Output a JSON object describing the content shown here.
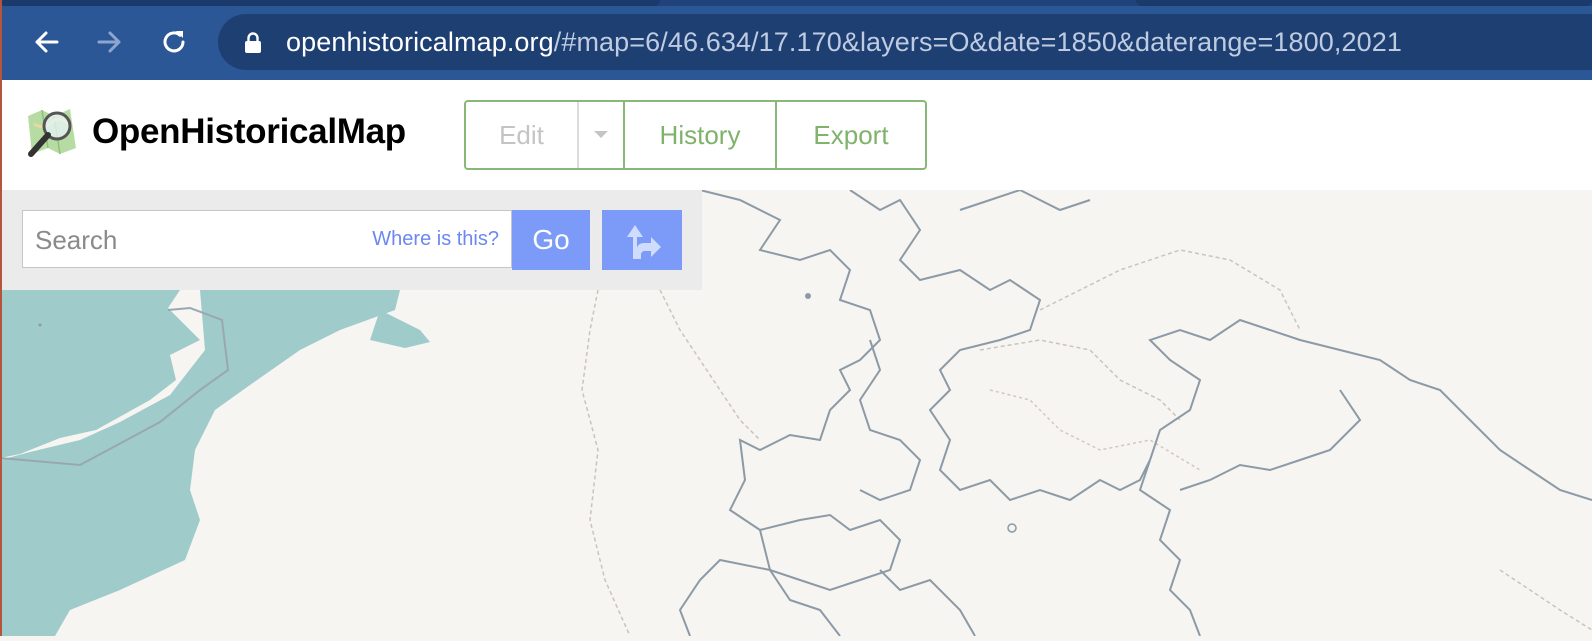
{
  "browser": {
    "url_domain": "openhistoricalmap.org",
    "url_rest": "/#map=6/46.634/17.170&layers=O&date=1850&daterange=1800,2021",
    "back_icon": "arrow-left-icon",
    "forward_icon": "arrow-right-icon",
    "reload_icon": "reload-icon",
    "lock_icon": "lock-icon"
  },
  "header": {
    "brand": "OpenHistoricalMap",
    "logo_icon": "magnifier-map-logo",
    "edit_label": "Edit",
    "history_label": "History",
    "export_label": "Export"
  },
  "search": {
    "placeholder": "Search",
    "where_label": "Where is this?",
    "go_label": "Go",
    "directions_icon": "directions-icon"
  },
  "colors": {
    "chrome": "#2b5797",
    "accent_green": "#7fb26a",
    "accent_blue": "#7c9bf8",
    "sea": "#a0cbcb",
    "land": "#f6f5f1",
    "border": "#8c9aa6"
  }
}
